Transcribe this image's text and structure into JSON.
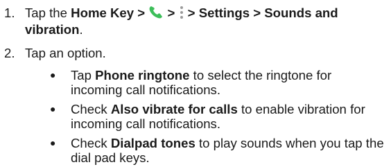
{
  "steps": [
    {
      "number": "1.",
      "pre": "Tap the ",
      "b1": "Home Key >",
      "gt1": " > ",
      "b2": " > Settings > Sounds and vibration",
      "end": "."
    },
    {
      "number": "2.",
      "text": "Tap an option."
    }
  ],
  "bullets": [
    {
      "lead": "Tap ",
      "bold": "Phone ringtone",
      "rest": " to select the ringtone for incoming call notifications."
    },
    {
      "lead": "Check ",
      "bold": "Also vibrate for calls",
      "rest": " to enable vibration for incoming call notifications."
    },
    {
      "lead": "Check ",
      "bold": "Dialpad tones",
      "rest": " to play sounds when you tap the dial pad keys."
    }
  ],
  "colors": {
    "phone_icon": "#3dbe5a",
    "menu_icon": "#9a9a9a"
  },
  "icons": {
    "phone": "phone-icon",
    "menu": "more-vertical-icon"
  }
}
